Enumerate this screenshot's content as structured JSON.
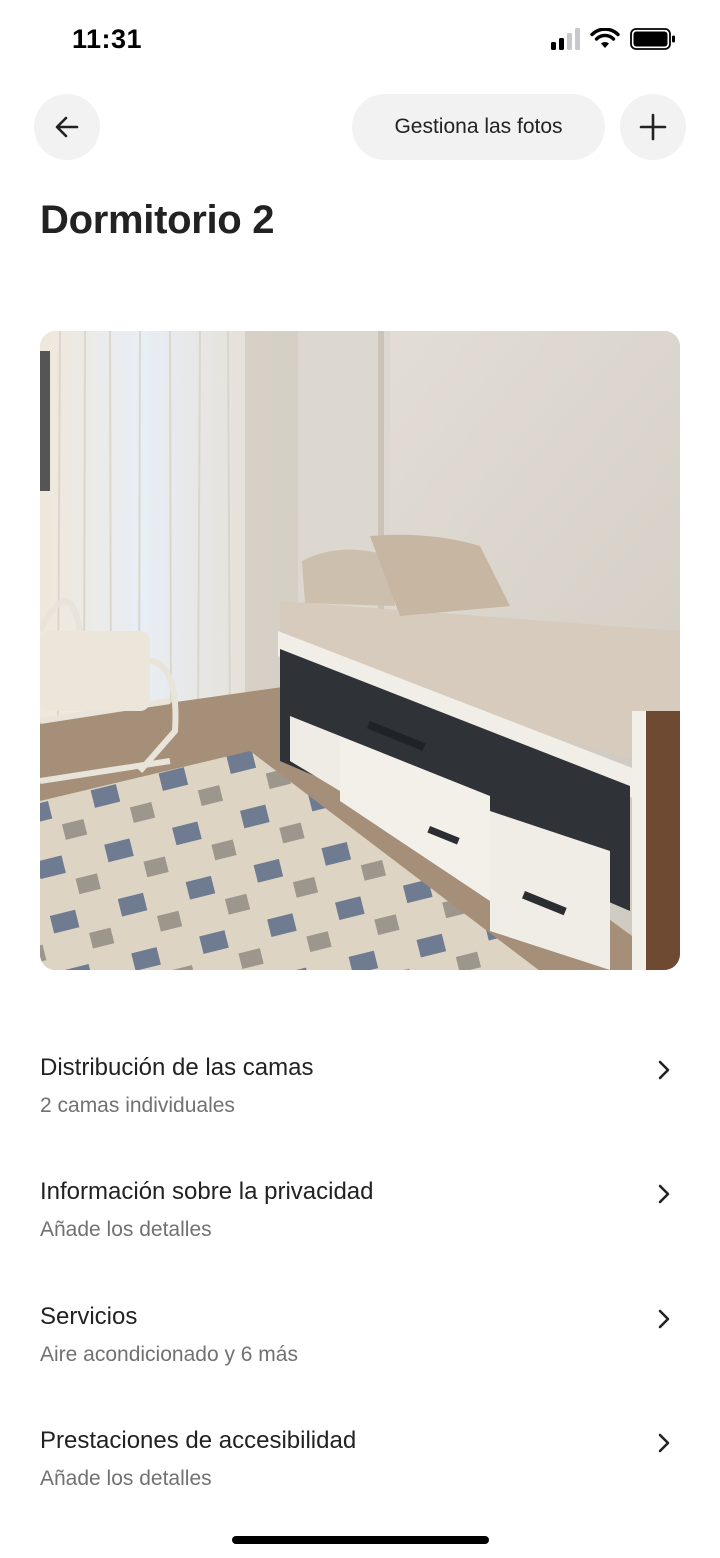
{
  "status_bar": {
    "time": "11:31"
  },
  "header": {
    "back_icon": "arrow-left-icon",
    "manage_photos_label": "Gestiona las fotos",
    "add_icon": "plus-icon"
  },
  "page": {
    "title": "Dormitorio 2"
  },
  "photo": {
    "description_icon": "bedroom-photo"
  },
  "list": {
    "items": [
      {
        "title": "Distribución de las camas",
        "subtitle": "2 camas individuales"
      },
      {
        "title": "Información sobre la privacidad",
        "subtitle": "Añade los detalles"
      },
      {
        "title": "Servicios",
        "subtitle": "Aire acondicionado y 6 más"
      },
      {
        "title": "Prestaciones de accesibilidad",
        "subtitle": "Añade los detalles"
      }
    ]
  },
  "colors": {
    "text": "#222222",
    "secondary_text": "#717171",
    "button_bg": "#f2f2f2"
  }
}
